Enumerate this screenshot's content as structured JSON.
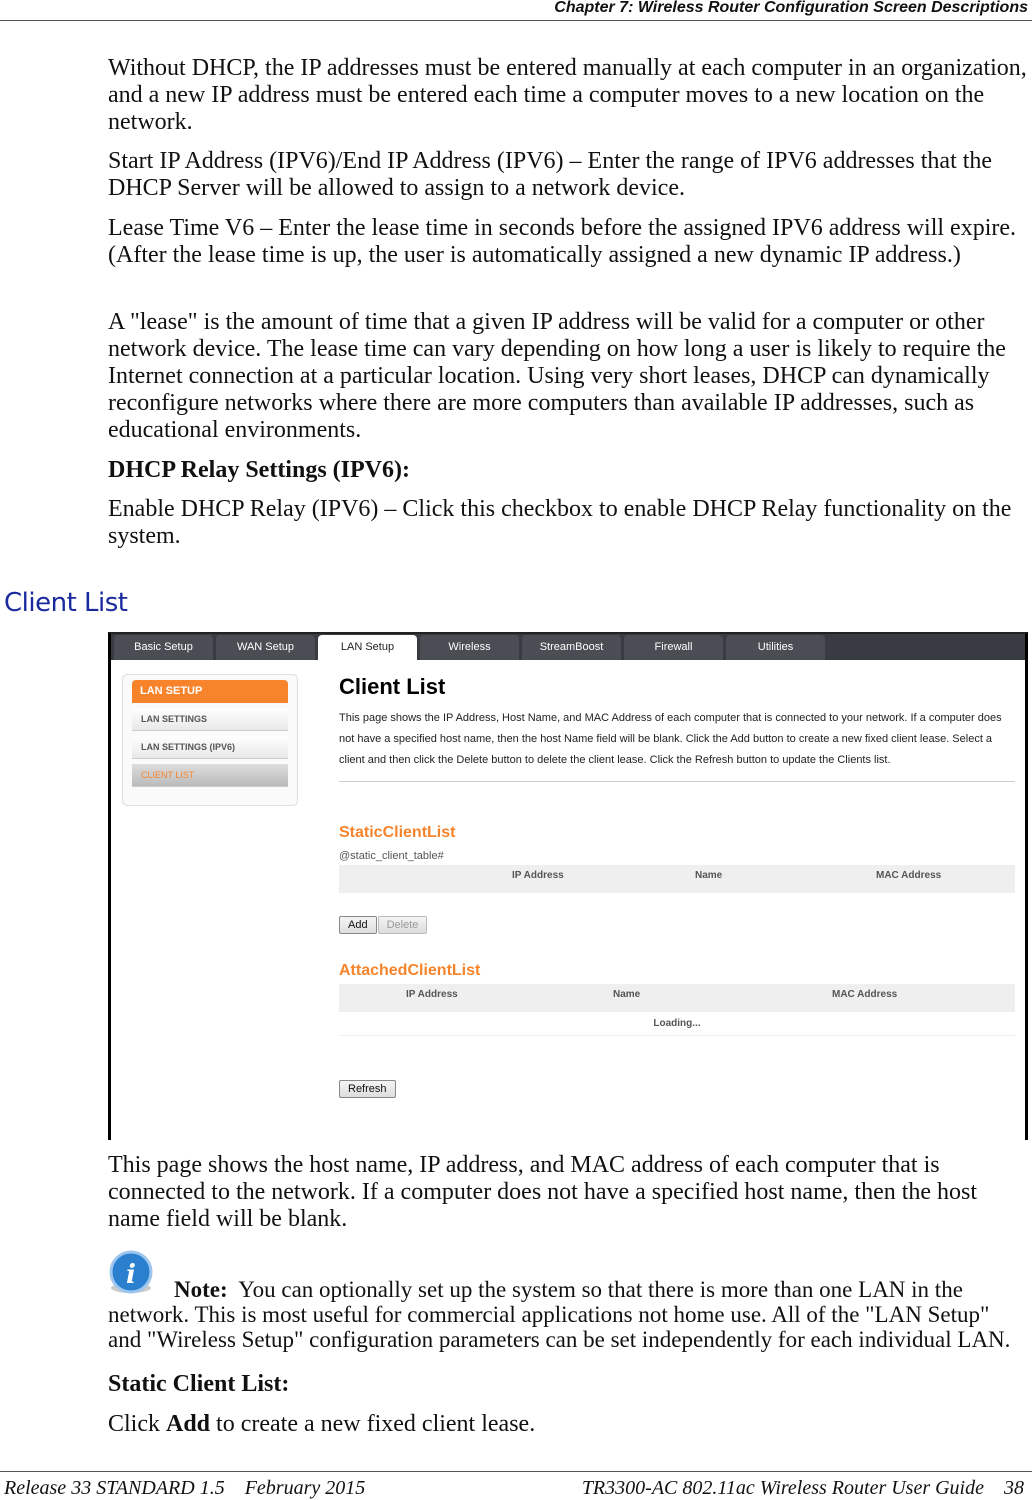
{
  "header": {
    "chapter": "Chapter 7: Wireless Router Configuration Screen Descriptions"
  },
  "paragraphs": [
    "Without DHCP, the IP addresses must be entered manually at each computer in an organization, and a new IP address must be entered each time a computer moves to a new location on the network.",
    "Start IP Address (IPV6)/End IP Address (IPV6) – Enter the range of IPV6 addresses that the DHCP Server will be allowed to assign to a network device.",
    "Lease Time V6  – Enter the lease time in seconds before the assigned IPV6 address will expire.  (After the lease time is up, the user is automatically assigned a new dynamic IP address.)",
    "A \"lease\" is the amount of time that a given IP address will be valid for a computer or other network device. The lease time can vary depending on how long a user is likely to require the Internet connection at a particular location.  Using very short leases, DHCP can dynamically reconfigure networks where there are more computers than available IP addresses, such as educational environments."
  ],
  "relay_heading": "DHCP Relay Settings (IPV6):",
  "relay_text": "Enable DHCP Relay (IPV6) – Click this checkbox to enable DHCP Relay functionality on the system.",
  "section_title": "Client List",
  "screenshot": {
    "tabs": [
      "Basic Setup",
      "WAN Setup",
      "LAN Setup",
      "Wireless",
      "StreamBoost",
      "Firewall",
      "Utilities"
    ],
    "active_tab": "LAN Setup",
    "sidebar": {
      "title": "LAN SETUP",
      "items": [
        "LAN SETTINGS",
        "LAN SETTINGS (IPV6)",
        "CLIENT LIST"
      ]
    },
    "title": "Client List",
    "description": "This page shows the IP Address, Host Name, and MAC Address of each computer that is connected to your network. If a computer does not have a specified host name, then the host Name field will be blank. Click the Add button to create a new fixed client lease. Select a client and then click the Delete button to delete the client lease. Click the Refresh button to update the Clients list.",
    "static": {
      "title": "StaticClientList",
      "placeholder": "@static_client_table#",
      "columns": [
        "IP Address",
        "Name",
        "MAC Address"
      ],
      "add": "Add",
      "delete": "Delete"
    },
    "attached": {
      "title": "AttachedClientList",
      "columns": [
        "IP Address",
        "Name",
        "MAC Address"
      ],
      "loading": "Loading...",
      "refresh": "Refresh"
    },
    "accent": "#f7842a"
  },
  "after_text": "This page shows the host name, IP address, and MAC address of each computer that is connected to the network.  If a computer does not have a specified host name, then the host name field will be blank.",
  "note": {
    "icon": "info-icon",
    "label": "Note:",
    "text": "You can optionally set up the system so that there is more than one LAN in the network.  This is most useful for commercial applications not home use.  All of the \"LAN Setup\" and \"Wireless Setup\" configuration parameters can be set independently for each individual LAN."
  },
  "static_heading": "Static Client List:",
  "static_text": {
    "pre": "Click ",
    "bold": "Add",
    "post": " to create a new fixed client lease."
  },
  "footer": {
    "left": "Release 33 STANDARD 1.5    February 2015",
    "right": "TR3300-AC 802.11ac Wireless Router User Guide    38"
  }
}
